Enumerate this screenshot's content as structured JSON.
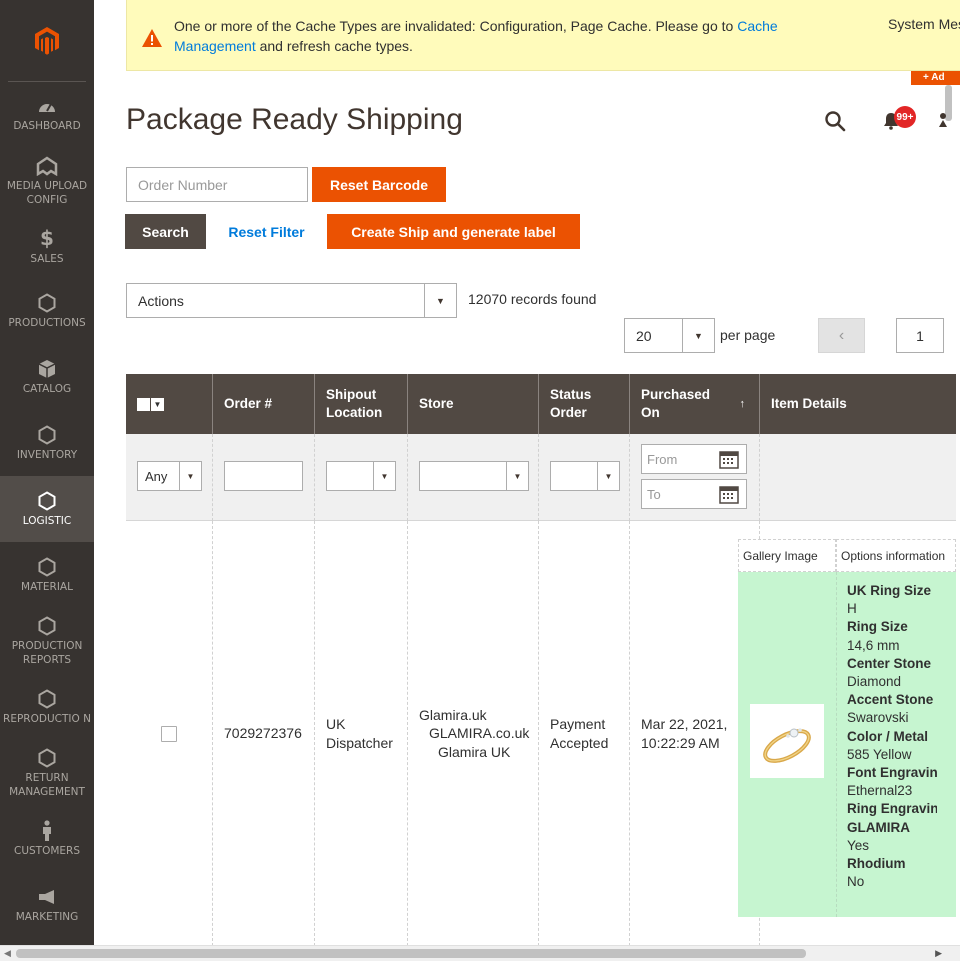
{
  "sidebar": {
    "items": [
      {
        "label": "DASHBOARD",
        "icon": "dashboard-icon"
      },
      {
        "label": "MEDIA UPLOAD CONFIG",
        "icon": "media-upload-icon"
      },
      {
        "label": "SALES",
        "icon": "dollar-icon"
      },
      {
        "label": "PRODUCTIONS",
        "icon": "hexagon-icon"
      },
      {
        "label": "CATALOG",
        "icon": "box-icon"
      },
      {
        "label": "INVENTORY",
        "icon": "hexagon-icon"
      },
      {
        "label": "LOGISTIC",
        "icon": "hexagon-icon"
      },
      {
        "label": "MATERIAL",
        "icon": "hexagon-icon"
      },
      {
        "label": "PRODUCTION REPORTS",
        "icon": "hexagon-icon"
      },
      {
        "label": "REPRODUCTIO N",
        "icon": "hexagon-icon"
      },
      {
        "label": "RETURN MANAGEMENT",
        "icon": "hexagon-icon"
      },
      {
        "label": "CUSTOMERS",
        "icon": "person-icon"
      },
      {
        "label": "MARKETING",
        "icon": "megaphone-icon"
      }
    ]
  },
  "notice": {
    "text_before": "One or more of the Cache Types are invalidated: Configuration, Page Cache. Please go to ",
    "link": "Cache Management",
    "text_after": " and refresh cache types.",
    "system": "System Messages"
  },
  "add_tag": "+ Ad",
  "header": {
    "title": "Package Ready Shipping",
    "notification_count": "99+"
  },
  "barcode": {
    "placeholder": "Order Number",
    "reset_label": "Reset Barcode"
  },
  "toolbar": {
    "search_label": "Search",
    "reset_filter_label": "Reset Filter",
    "create_ship_label": "Create Ship and generate label",
    "actions_label": "Actions",
    "records_found": "12070 records found",
    "per_page_value": "20",
    "per_page_label": "per page",
    "page_number": "1"
  },
  "grid": {
    "columns": [
      "Order #",
      "Shipout Location",
      "Store",
      "Status Order",
      "Purchased On",
      "Item Details"
    ],
    "sort_indicator": "↑",
    "filters": {
      "any": "Any",
      "from": "From",
      "to": "To"
    },
    "row": {
      "order": "7029272376",
      "shipout": "UK Dispatcher",
      "store_lines": [
        "Glamira.uk",
        "GLAMIRA.co.uk",
        "Glamira UK"
      ],
      "status": "Payment Accepted",
      "purchased": "Mar 22, 2021, 10:22:29 AM"
    },
    "detail": {
      "gallery_header": "Gallery Image",
      "options_header": "Options information",
      "options": [
        {
          "label": "UK Ring Size",
          "value": "H"
        },
        {
          "label": "Ring Size",
          "value": "14,6 mm"
        },
        {
          "label": "Center Stone",
          "value": "Diamond"
        },
        {
          "label": "Accent Stone",
          "value": "Swarovski"
        },
        {
          "label": "Color / Metal",
          "value": "585 Yellow"
        },
        {
          "label": "Font Engraving",
          "value": "Ethernal23"
        },
        {
          "label": "Ring Engraving",
          "value": ""
        },
        {
          "label": "GLAMIRA",
          "value": "Yes"
        },
        {
          "label": "Rhodium",
          "value": "No"
        }
      ]
    }
  }
}
